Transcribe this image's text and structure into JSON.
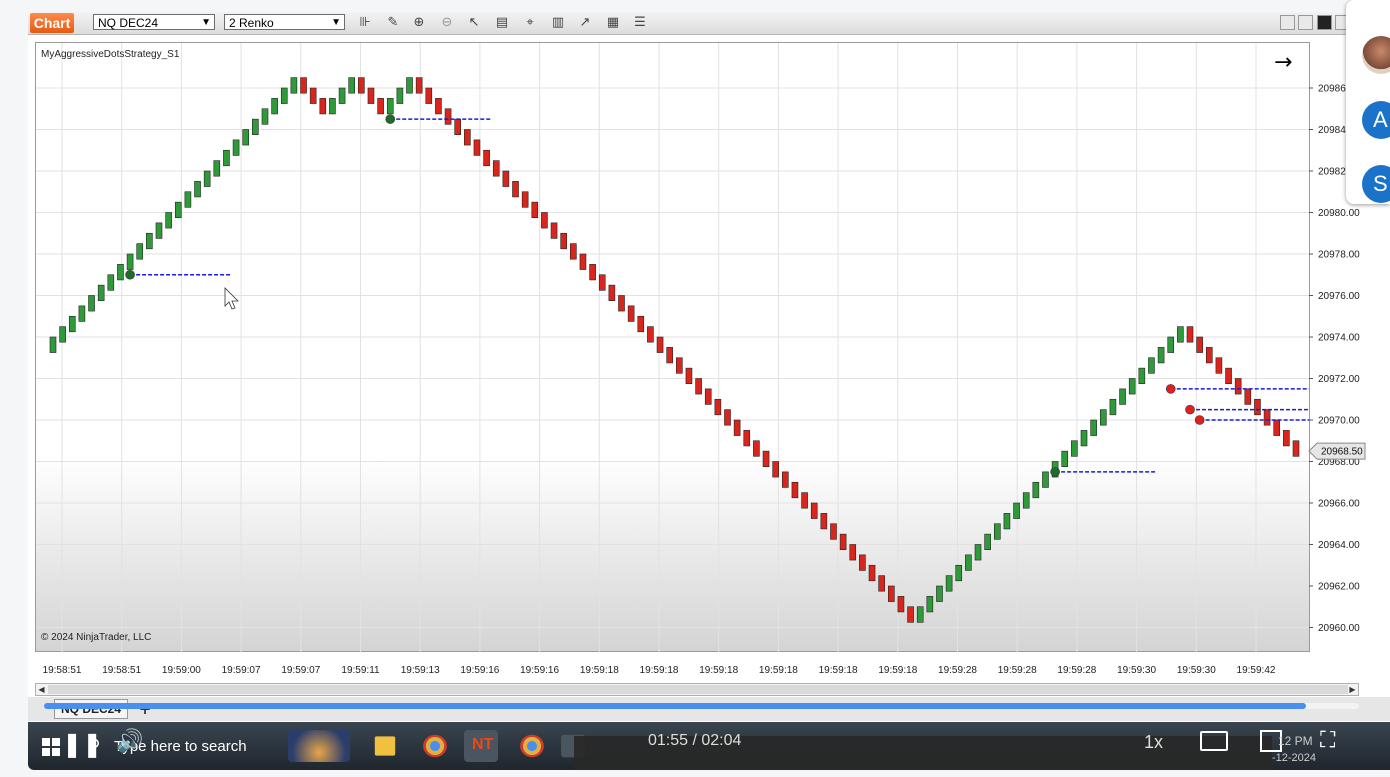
{
  "toolbar": {
    "chart_tab": "Chart",
    "instrument": "NQ DEC24",
    "bar_type": "2 Renko"
  },
  "chart": {
    "strategy_label": "MyAggressiveDotsStrategy_S1",
    "copyright": "© 2024 NinjaTrader, LLC",
    "current_price_label": "20968.50",
    "price_ticks": [
      "20986.00",
      "20984.00",
      "20982.00",
      "20980.00",
      "20978.00",
      "20976.00",
      "20974.00",
      "20972.00",
      "20970.00",
      "20968.00",
      "20966.00",
      "20964.00",
      "20962.00",
      "20960.00"
    ],
    "time_labels": [
      "19:58:51",
      "19:58:51",
      "19:59:00",
      "19:59:07",
      "19:59:07",
      "19:59:11",
      "19:59:13",
      "19:59:16",
      "19:59:16",
      "19:59:18",
      "19:59:18",
      "19:59:18",
      "19:59:18",
      "19:59:18",
      "19:59:18",
      "19:59:28",
      "19:59:28",
      "19:59:28",
      "19:59:30",
      "19:59:30",
      "19:59:42"
    ],
    "colors": {
      "up": "#2f9a3a",
      "down": "#d9261c",
      "signal_line": "#1a1ad9",
      "price_marker": "#e6e6e6"
    }
  },
  "chart_data": {
    "type": "renko",
    "brick_size": 2,
    "brick_count": 123,
    "ylim": [
      20959,
      20987.5
    ],
    "segments": [
      {
        "direction": "up",
        "from": 20973.5,
        "to": 20986.5
      },
      {
        "direction": "down",
        "from": 20986.5,
        "to": 20985
      },
      {
        "direction": "up",
        "from": 20985,
        "to": 20986.5
      },
      {
        "direction": "down",
        "from": 20986.5,
        "to": 20985
      },
      {
        "direction": "up",
        "from": 20985,
        "to": 20986.5
      },
      {
        "direction": "down",
        "from": 20986.5,
        "to": 20960.5
      },
      {
        "direction": "up",
        "from": 20960.5,
        "to": 20974.5
      },
      {
        "direction": "down",
        "from": 20974.5,
        "to": 20968.5
      }
    ],
    "signals": [
      {
        "price": 20977.0,
        "color": "green"
      },
      {
        "price": 20984.5,
        "color": "green"
      },
      {
        "price": 20967.5,
        "color": "green"
      },
      {
        "price": 20971.5,
        "color": "red"
      },
      {
        "price": 20970.5,
        "color": "red"
      },
      {
        "price": 20970.0,
        "color": "red"
      }
    ]
  },
  "tabs": {
    "instrument_tab": "NQ DEC24",
    "add": "+"
  },
  "taskbar": {
    "search_placeholder": "Type here to search"
  },
  "video": {
    "time": "01:55 / 02:04",
    "speed": "1x",
    "progress": 0.96
  },
  "tray": {
    "clock_time": "12 PM",
    "clock_date": "-12-2024"
  },
  "participants": [
    {
      "initial": "A",
      "color": "#1a73c8"
    },
    {
      "initial": "S",
      "color": "#1a73c8"
    }
  ]
}
